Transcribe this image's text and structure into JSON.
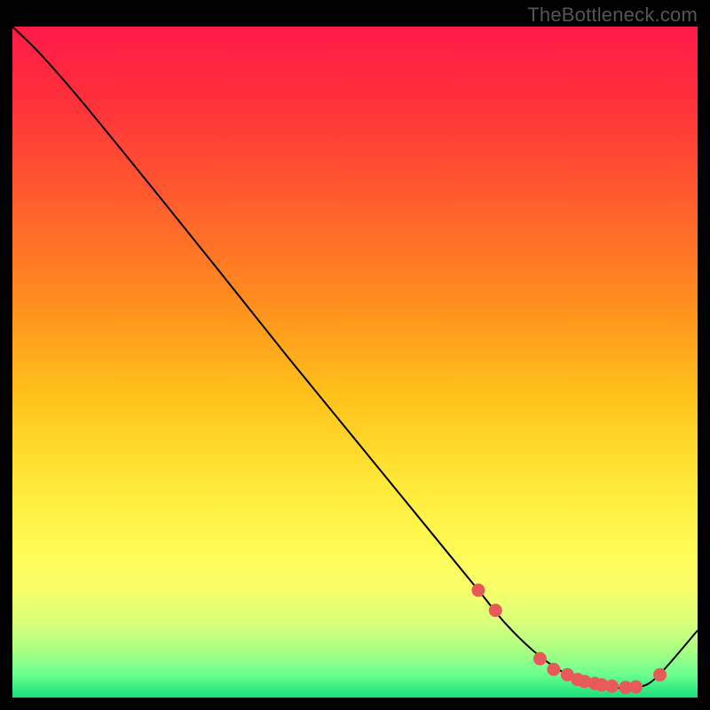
{
  "attribution": "TheBottleneck.com",
  "chart_data": {
    "type": "line",
    "title": "",
    "xlabel": "",
    "ylabel": "",
    "xlim": [
      0,
      100
    ],
    "ylim": [
      0,
      100
    ],
    "grid": false,
    "curve": {
      "x": [
        0,
        4,
        10,
        20,
        30,
        40,
        50,
        60,
        68,
        72,
        76,
        80,
        84,
        88,
        91,
        94,
        100
      ],
      "y": [
        100,
        96,
        89,
        76.5,
        63.8,
        51,
        38.5,
        26,
        16,
        11,
        7,
        4,
        2.2,
        1.5,
        1.5,
        3,
        10
      ]
    },
    "markers": {
      "x": [
        68,
        70.5,
        77,
        79,
        81,
        82.5,
        83.5,
        85,
        86,
        87.5,
        89.5,
        91,
        94.5
      ],
      "y": [
        16,
        13,
        5.8,
        4.2,
        3.4,
        2.7,
        2.4,
        2.1,
        1.9,
        1.7,
        1.5,
        1.6,
        3.4
      ]
    },
    "gradient_stops": [
      {
        "offset": 0.0,
        "color": "#ff1a48"
      },
      {
        "offset": 0.1,
        "color": "#ff2e3b"
      },
      {
        "offset": 0.25,
        "color": "#ff5a2e"
      },
      {
        "offset": 0.4,
        "color": "#ff8a1e"
      },
      {
        "offset": 0.55,
        "color": "#ffc21a"
      },
      {
        "offset": 0.68,
        "color": "#ffe838"
      },
      {
        "offset": 0.78,
        "color": "#fffb55"
      },
      {
        "offset": 0.84,
        "color": "#f8ff6a"
      },
      {
        "offset": 0.89,
        "color": "#d8ff7a"
      },
      {
        "offset": 0.93,
        "color": "#a9ff84"
      },
      {
        "offset": 0.965,
        "color": "#6cff8e"
      },
      {
        "offset": 1.0,
        "color": "#18e07b"
      }
    ],
    "line_color": "#000",
    "marker_color": "#e85a5a"
  }
}
